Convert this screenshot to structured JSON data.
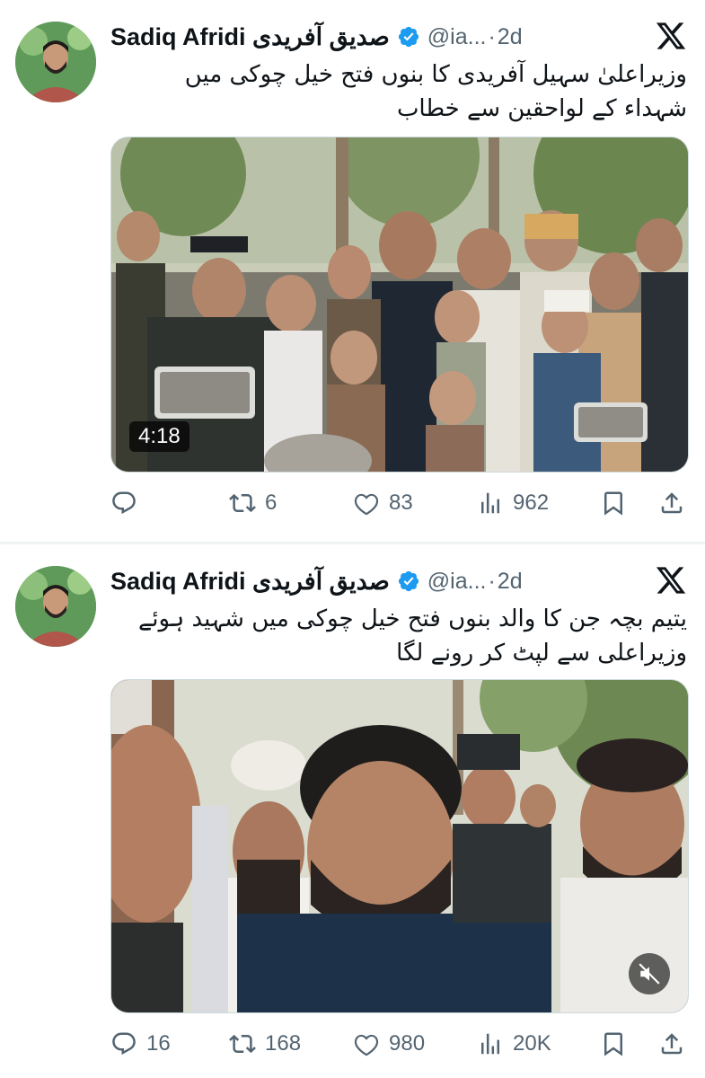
{
  "colors": {
    "verified": "#1d9bf0",
    "muted_text": "#536471",
    "text": "#0f1419",
    "separator": "#eff3f4"
  },
  "tweets": [
    {
      "name": "Sadiq Afridi صدیق آفریدی",
      "handle": "@ia...",
      "separator": "·",
      "time": "2d",
      "text_line1": "وزیراعلیٰ سہیل آفریدی کا بنوں فتح خیل چوکی میں",
      "text_line2": "شہداء کے لواحقین سے خطاب",
      "video_duration": "4:18",
      "replies": "",
      "reposts": "6",
      "likes": "83",
      "views": "962"
    },
    {
      "name": "Sadiq Afridi صدیق آفریدی",
      "handle": "@ia...",
      "separator": "·",
      "time": "2d",
      "text_line1": "یتیم بچہ جن کا والد بنوں فتح خیل چوکی میں شہید ہوئے",
      "text_line2": "وزیراعلی سے لپٹ کر رونے لگا",
      "replies": "16",
      "reposts": "168",
      "likes": "980",
      "views": "20K"
    }
  ],
  "icons": {
    "reply": "speech-bubble-icon",
    "repost": "repost-arrows-icon",
    "like": "heart-icon",
    "views": "bar-chart-icon",
    "bookmark": "bookmark-icon",
    "share": "share-upload-icon",
    "platform": "x-logo-icon",
    "verified": "verified-badge-icon",
    "mute": "muted-speaker-icon"
  }
}
